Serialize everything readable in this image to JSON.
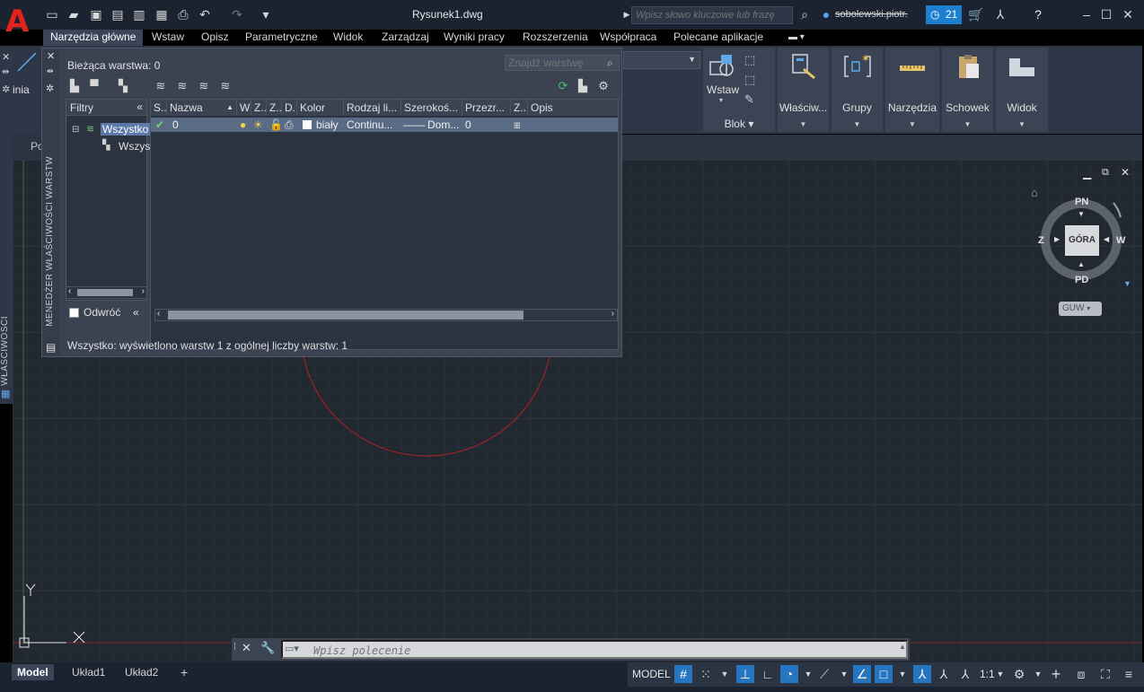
{
  "window": {
    "title": "Rysunek1.dwg",
    "search_placeholder": "Wpisz słowo kluczowe lub frazę",
    "user": "sobolewski.piotr.",
    "timer_count": "21"
  },
  "ribbon_tabs": [
    {
      "label": "Narzędzia główne"
    },
    {
      "label": "Wstaw"
    },
    {
      "label": "Opisz"
    },
    {
      "label": "Parametryczne"
    },
    {
      "label": "Widok"
    },
    {
      "label": "Zarządzaj"
    },
    {
      "label": "Wyniki pracy"
    },
    {
      "label": "Rozszerzenia"
    },
    {
      "label": "Współpraca"
    },
    {
      "label": "Polecane aplikacje"
    }
  ],
  "ribbon_panels": {
    "insert_label": "Wstaw",
    "block_label": "Blok",
    "properties_label": "Właściw...",
    "groups_label": "Grupy",
    "utilities_label": "Narzędzia",
    "clipboard_label": "Schowek",
    "view_label": "Widok"
  },
  "left_tools": {
    "line_label": "inia"
  },
  "doc_tab": {
    "label": "Po"
  },
  "properties_strip": {
    "label": "WŁAŚCIWOŚCI"
  },
  "layer_palette": {
    "title": "MENEDŻER WŁAŚCIWOŚCI WARSTW",
    "current_layer": "Bieżąca warstwa: 0",
    "search_placeholder": "Znajdź warstwę",
    "filters_header": "Filtry",
    "tree_all": "Wszystko",
    "tree_sub": "Wszys",
    "invert_label": "Odwróć",
    "columns": [
      {
        "label": "S.."
      },
      {
        "label": "Nazwa"
      },
      {
        "label": "W"
      },
      {
        "label": "Z.."
      },
      {
        "label": "Z.."
      },
      {
        "label": "D.."
      },
      {
        "label": "Kolor"
      },
      {
        "label": "Rodzaj li..."
      },
      {
        "label": "Szerokoś..."
      },
      {
        "label": "Przezr..."
      },
      {
        "label": "Z.."
      },
      {
        "label": "Opis"
      }
    ],
    "row": {
      "name": "0",
      "color": "biały",
      "linetype": "Continu...",
      "lineweight": "Dom...",
      "transparency": "0"
    },
    "status": "Wszystko: wyświetlono warstw 1 z ogólnej liczby warstw: 1"
  },
  "viewcube": {
    "face": "GÓRA",
    "north": "PN",
    "south": "PD",
    "west": "Z",
    "east": "W",
    "wcs": "GUW"
  },
  "command_line": {
    "placeholder": "Wpisz polecenie"
  },
  "layout_tabs": [
    {
      "label": "Model"
    },
    {
      "label": "Układ1"
    },
    {
      "label": "Układ2"
    }
  ],
  "status_bar": {
    "model": "MODEL",
    "scale": "1:1"
  },
  "colors": {
    "accent": "#2675c0",
    "circle": "#b22222",
    "logo": "#e2231a"
  }
}
